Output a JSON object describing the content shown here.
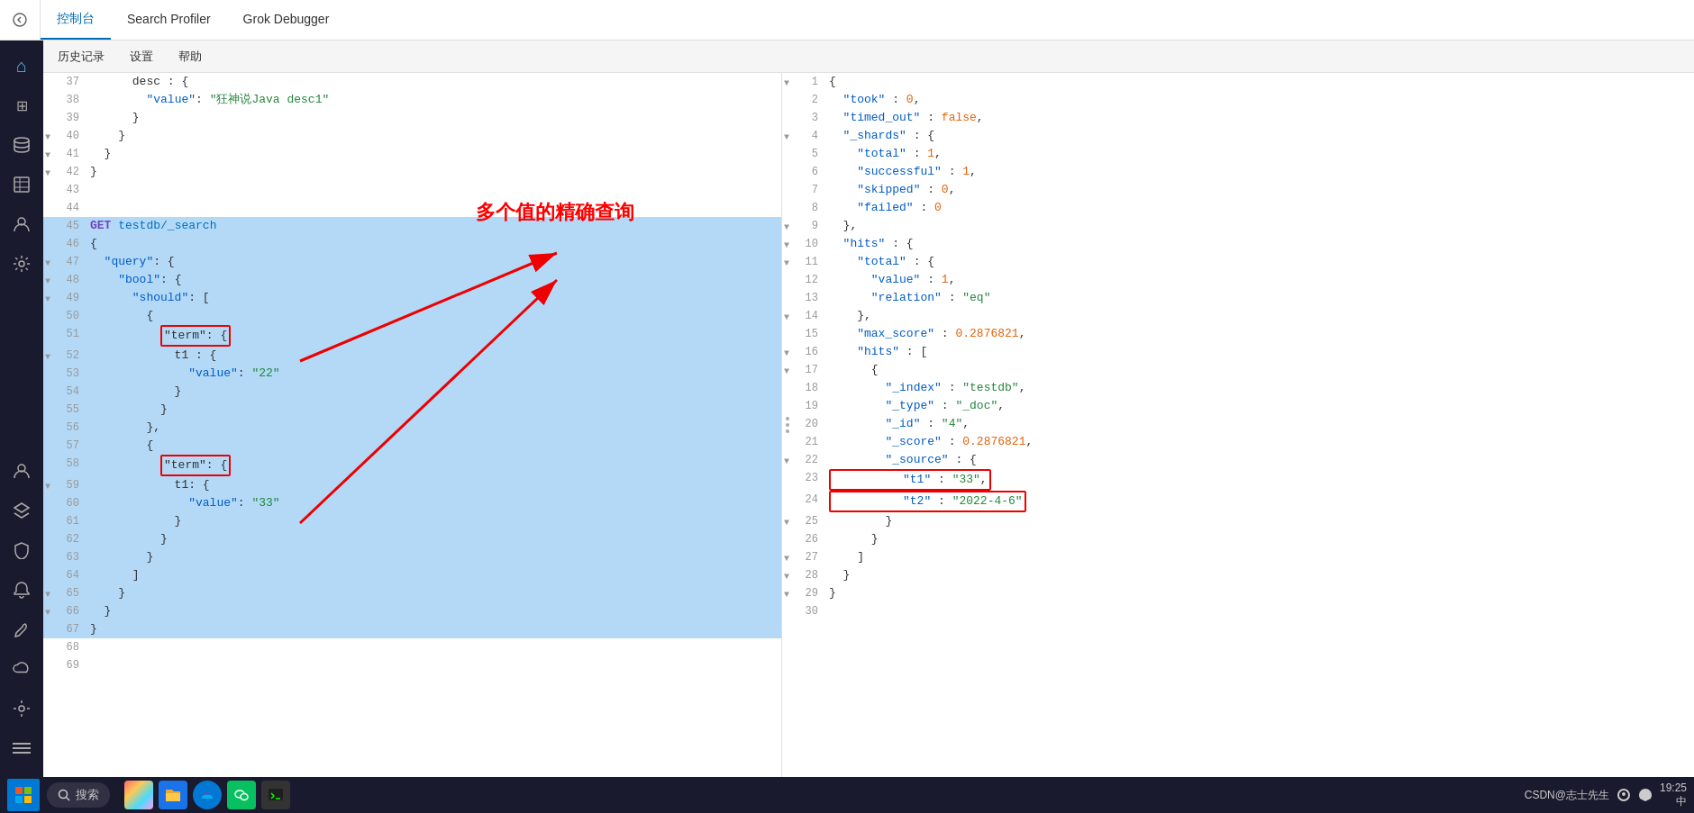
{
  "topNav": {
    "backLabel": "◀",
    "tabs": [
      {
        "id": "console",
        "label": "控制台",
        "active": true
      },
      {
        "id": "search-profiler",
        "label": "Search Profiler",
        "active": false
      },
      {
        "id": "grok-debugger",
        "label": "Grok Debugger",
        "active": false
      }
    ]
  },
  "secondaryNav": {
    "items": [
      "历史记录",
      "设置",
      "帮助"
    ]
  },
  "annotation": {
    "text": "多个值的精确查询"
  },
  "leftEditor": {
    "lines": [
      {
        "num": "37",
        "fold": false,
        "indent": 3,
        "content": "desc : {",
        "type": "normal"
      },
      {
        "num": "38",
        "fold": false,
        "indent": 4,
        "content": "\"value\": \"狂神说Java desc1\"",
        "type": "string-value"
      },
      {
        "num": "39",
        "fold": false,
        "indent": 3,
        "content": "}",
        "type": "normal"
      },
      {
        "num": "40",
        "fold": true,
        "indent": 2,
        "content": "}",
        "type": "normal"
      },
      {
        "num": "41",
        "fold": true,
        "indent": 1,
        "content": "}",
        "type": "normal"
      },
      {
        "num": "42",
        "fold": true,
        "indent": 0,
        "content": "}",
        "type": "normal"
      },
      {
        "num": "43",
        "fold": false,
        "indent": 0,
        "content": "",
        "type": "empty"
      },
      {
        "num": "44",
        "fold": false,
        "indent": 0,
        "content": "",
        "type": "empty"
      },
      {
        "num": "45",
        "fold": false,
        "indent": 0,
        "content": "GET testdb/_search",
        "type": "method",
        "selected": true
      },
      {
        "num": "46",
        "fold": false,
        "indent": 0,
        "content": "{",
        "type": "normal",
        "selected": true
      },
      {
        "num": "47",
        "fold": true,
        "indent": 1,
        "content": "\"query\": {",
        "type": "key",
        "selected": true
      },
      {
        "num": "48",
        "fold": true,
        "indent": 2,
        "content": "\"bool\": {",
        "type": "key",
        "selected": true
      },
      {
        "num": "49",
        "fold": true,
        "indent": 3,
        "content": "\"should\": [",
        "type": "key",
        "selected": true
      },
      {
        "num": "50",
        "fold": false,
        "indent": 4,
        "content": "{",
        "type": "normal",
        "selected": true
      },
      {
        "num": "51",
        "fold": false,
        "indent": 5,
        "content": "\"term\": {",
        "type": "key-term",
        "selected": true,
        "termBox": true
      },
      {
        "num": "52",
        "fold": true,
        "indent": 6,
        "content": "t1 : {",
        "type": "normal",
        "selected": true
      },
      {
        "num": "53",
        "fold": false,
        "indent": 7,
        "content": "\"value\": \"22\"",
        "type": "string-value",
        "selected": true
      },
      {
        "num": "54",
        "fold": false,
        "indent": 6,
        "content": "}",
        "type": "normal",
        "selected": true
      },
      {
        "num": "55",
        "fold": false,
        "indent": 5,
        "content": "}",
        "type": "normal",
        "selected": true
      },
      {
        "num": "56",
        "fold": false,
        "indent": 4,
        "content": "},",
        "type": "normal",
        "selected": true
      },
      {
        "num": "57",
        "fold": false,
        "indent": 4,
        "content": "{",
        "type": "normal",
        "selected": true
      },
      {
        "num": "58",
        "fold": false,
        "indent": 5,
        "content": "\"term\": {",
        "type": "key-term",
        "selected": true,
        "termBox": true
      },
      {
        "num": "59",
        "fold": true,
        "indent": 6,
        "content": "t1: {",
        "type": "normal",
        "selected": true
      },
      {
        "num": "60",
        "fold": false,
        "indent": 7,
        "content": "\"value\": \"33\"",
        "type": "string-value",
        "selected": true
      },
      {
        "num": "61",
        "fold": false,
        "indent": 6,
        "content": "}",
        "type": "normal",
        "selected": true
      },
      {
        "num": "62",
        "fold": false,
        "indent": 5,
        "content": "}",
        "type": "normal",
        "selected": true
      },
      {
        "num": "63",
        "fold": false,
        "indent": 4,
        "content": "}",
        "type": "normal",
        "selected": true
      },
      {
        "num": "64",
        "fold": false,
        "indent": 3,
        "content": "]",
        "type": "normal",
        "selected": true
      },
      {
        "num": "65",
        "fold": true,
        "indent": 2,
        "content": "}",
        "type": "normal",
        "selected": true
      },
      {
        "num": "66",
        "fold": true,
        "indent": 1,
        "content": "}",
        "type": "normal",
        "selected": true
      },
      {
        "num": "67",
        "fold": false,
        "indent": 0,
        "content": "}",
        "type": "normal",
        "selected": true
      },
      {
        "num": "68",
        "fold": false,
        "indent": 0,
        "content": "",
        "type": "empty"
      },
      {
        "num": "69",
        "fold": false,
        "indent": 0,
        "content": "",
        "type": "empty"
      }
    ]
  },
  "rightEditor": {
    "lines": [
      {
        "num": "1",
        "fold": true,
        "content": "{"
      },
      {
        "num": "2",
        "fold": false,
        "content": "  \"took\" : 0,"
      },
      {
        "num": "3",
        "fold": false,
        "content": "  \"timed_out\" : false,"
      },
      {
        "num": "4",
        "fold": true,
        "content": "  \"_shards\" : {"
      },
      {
        "num": "5",
        "fold": false,
        "content": "    \"total\" : 1,"
      },
      {
        "num": "6",
        "fold": false,
        "content": "    \"successful\" : 1,"
      },
      {
        "num": "7",
        "fold": false,
        "content": "    \"skipped\" : 0,"
      },
      {
        "num": "8",
        "fold": false,
        "content": "    \"failed\" : 0"
      },
      {
        "num": "9",
        "fold": true,
        "content": "  },"
      },
      {
        "num": "10",
        "fold": true,
        "content": "  \"hits\" : {"
      },
      {
        "num": "11",
        "fold": true,
        "content": "    \"total\" : {"
      },
      {
        "num": "12",
        "fold": false,
        "content": "      \"value\" : 1,"
      },
      {
        "num": "13",
        "fold": false,
        "content": "      \"relation\" : \"eq\""
      },
      {
        "num": "14",
        "fold": true,
        "content": "    },"
      },
      {
        "num": "15",
        "fold": false,
        "content": "    \"max_score\" : 0.2876821,"
      },
      {
        "num": "16",
        "fold": true,
        "content": "    \"hits\" : ["
      },
      {
        "num": "17",
        "fold": true,
        "content": "      {"
      },
      {
        "num": "18",
        "fold": false,
        "content": "        \"_index\" : \"testdb\","
      },
      {
        "num": "19",
        "fold": false,
        "content": "        \"_type\" : \"_doc\","
      },
      {
        "num": "20",
        "fold": false,
        "content": "        \"_id\" : \"4\","
      },
      {
        "num": "21",
        "fold": false,
        "content": "        \"_score\" : 0.2876821,"
      },
      {
        "num": "22",
        "fold": true,
        "content": "        \"_source\" : {"
      },
      {
        "num": "23",
        "fold": false,
        "content": "          \"t1\" : \"33\",",
        "resultBox": true
      },
      {
        "num": "24",
        "fold": false,
        "content": "          \"t2\" : \"2022-4-6\"",
        "resultBox": true
      },
      {
        "num": "25",
        "fold": true,
        "content": "        }"
      },
      {
        "num": "26",
        "fold": false,
        "content": "      }"
      },
      {
        "num": "27",
        "fold": true,
        "content": "    ]"
      },
      {
        "num": "28",
        "fold": true,
        "content": "  }"
      },
      {
        "num": "29",
        "fold": true,
        "content": "}"
      },
      {
        "num": "30",
        "fold": false,
        "content": ""
      }
    ]
  },
  "sidebar": {
    "icons": [
      {
        "name": "home",
        "symbol": "⌂",
        "active": false
      },
      {
        "name": "grid",
        "symbol": "⊞",
        "active": false
      },
      {
        "name": "database",
        "symbol": "🗄",
        "active": false
      },
      {
        "name": "table",
        "symbol": "▦",
        "active": false
      },
      {
        "name": "person",
        "symbol": "👤",
        "active": false
      },
      {
        "name": "settings-gear",
        "symbol": "⚙",
        "active": false
      },
      {
        "name": "layers",
        "symbol": "≡",
        "active": false
      },
      {
        "name": "person-outline",
        "symbol": "👥",
        "active": false
      },
      {
        "name": "shield",
        "symbol": "🛡",
        "active": false
      },
      {
        "name": "bell",
        "symbol": "🔔",
        "active": false
      },
      {
        "name": "wrench",
        "symbol": "🔧",
        "active": false
      },
      {
        "name": "cloud",
        "symbol": "☁",
        "active": false
      },
      {
        "name": "cog",
        "symbol": "⚙",
        "active": false
      },
      {
        "name": "menu",
        "symbol": "☰",
        "active": false
      }
    ]
  },
  "taskbar": {
    "searchLabel": "搜索",
    "timeLabel": "19:25",
    "dateLabel": "中",
    "userLabel": "CSDN@志士先生"
  }
}
